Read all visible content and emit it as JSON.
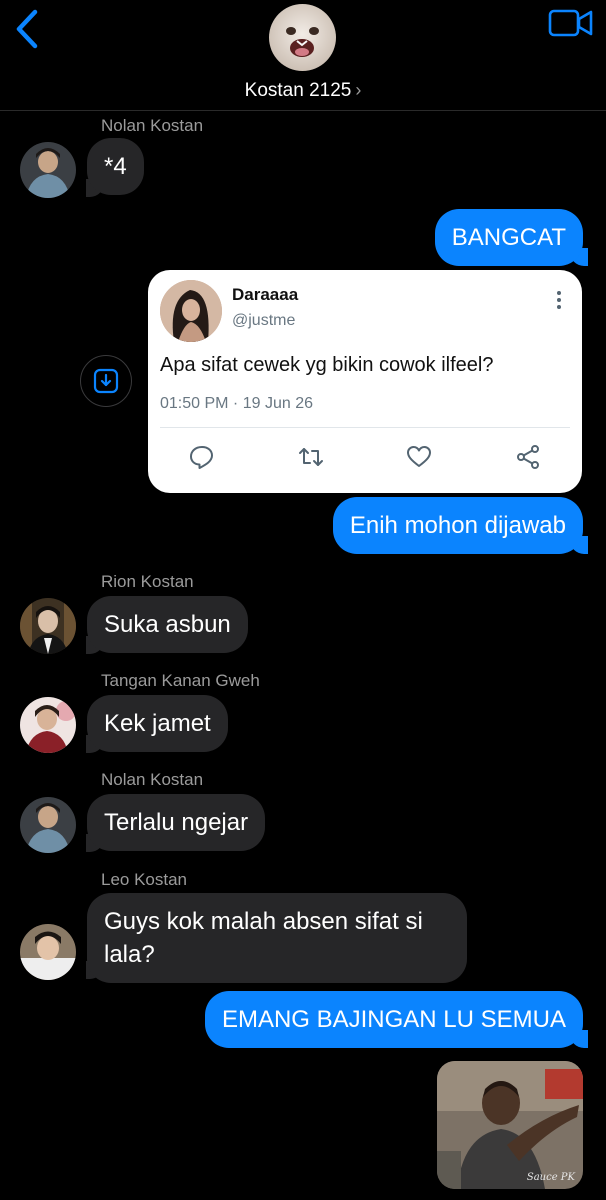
{
  "header": {
    "title": "Kostan 2125",
    "chevron": "›",
    "back_icon": "chevron-left-icon",
    "video_icon": "video-camera-icon"
  },
  "colors": {
    "accent": "#0B84FE",
    "incoming_bubble": "#262628",
    "background": "#000000",
    "sender_label": "#9B9B9B"
  },
  "messages": [
    {
      "sender": "Nolan Kostan",
      "direction": "incoming",
      "text": "*4"
    },
    {
      "direction": "outgoing",
      "text": "BANGCAT"
    },
    {
      "direction": "outgoing",
      "type": "tweet-card",
      "tweet": {
        "name": "Daraaaa",
        "handle": "@justme",
        "text": "Apa sifat cewek yg bikin cowok ilfeel?",
        "timestamp": "01:50 PM · 19 Jun 26",
        "actions": [
          "reply-icon",
          "retweet-icon",
          "like-icon",
          "share-icon"
        ]
      }
    },
    {
      "direction": "outgoing",
      "text": "Enih mohon dijawab"
    },
    {
      "sender": "Rion Kostan",
      "direction": "incoming",
      "text": "Suka asbun"
    },
    {
      "sender": "Tangan Kanan Gweh",
      "direction": "incoming",
      "text": "Kek jamet"
    },
    {
      "sender": "Nolan Kostan",
      "direction": "incoming",
      "text": "Terlalu ngejar"
    },
    {
      "sender": "Leo Kostan",
      "direction": "incoming",
      "text_lines": [
        "Guys kok malah absen sifat si",
        "lala?"
      ]
    },
    {
      "direction": "outgoing",
      "text": "EMANG BAJINGAN LU SEMUA"
    },
    {
      "direction": "outgoing",
      "type": "image",
      "watermark": "Sauce PK"
    }
  ]
}
